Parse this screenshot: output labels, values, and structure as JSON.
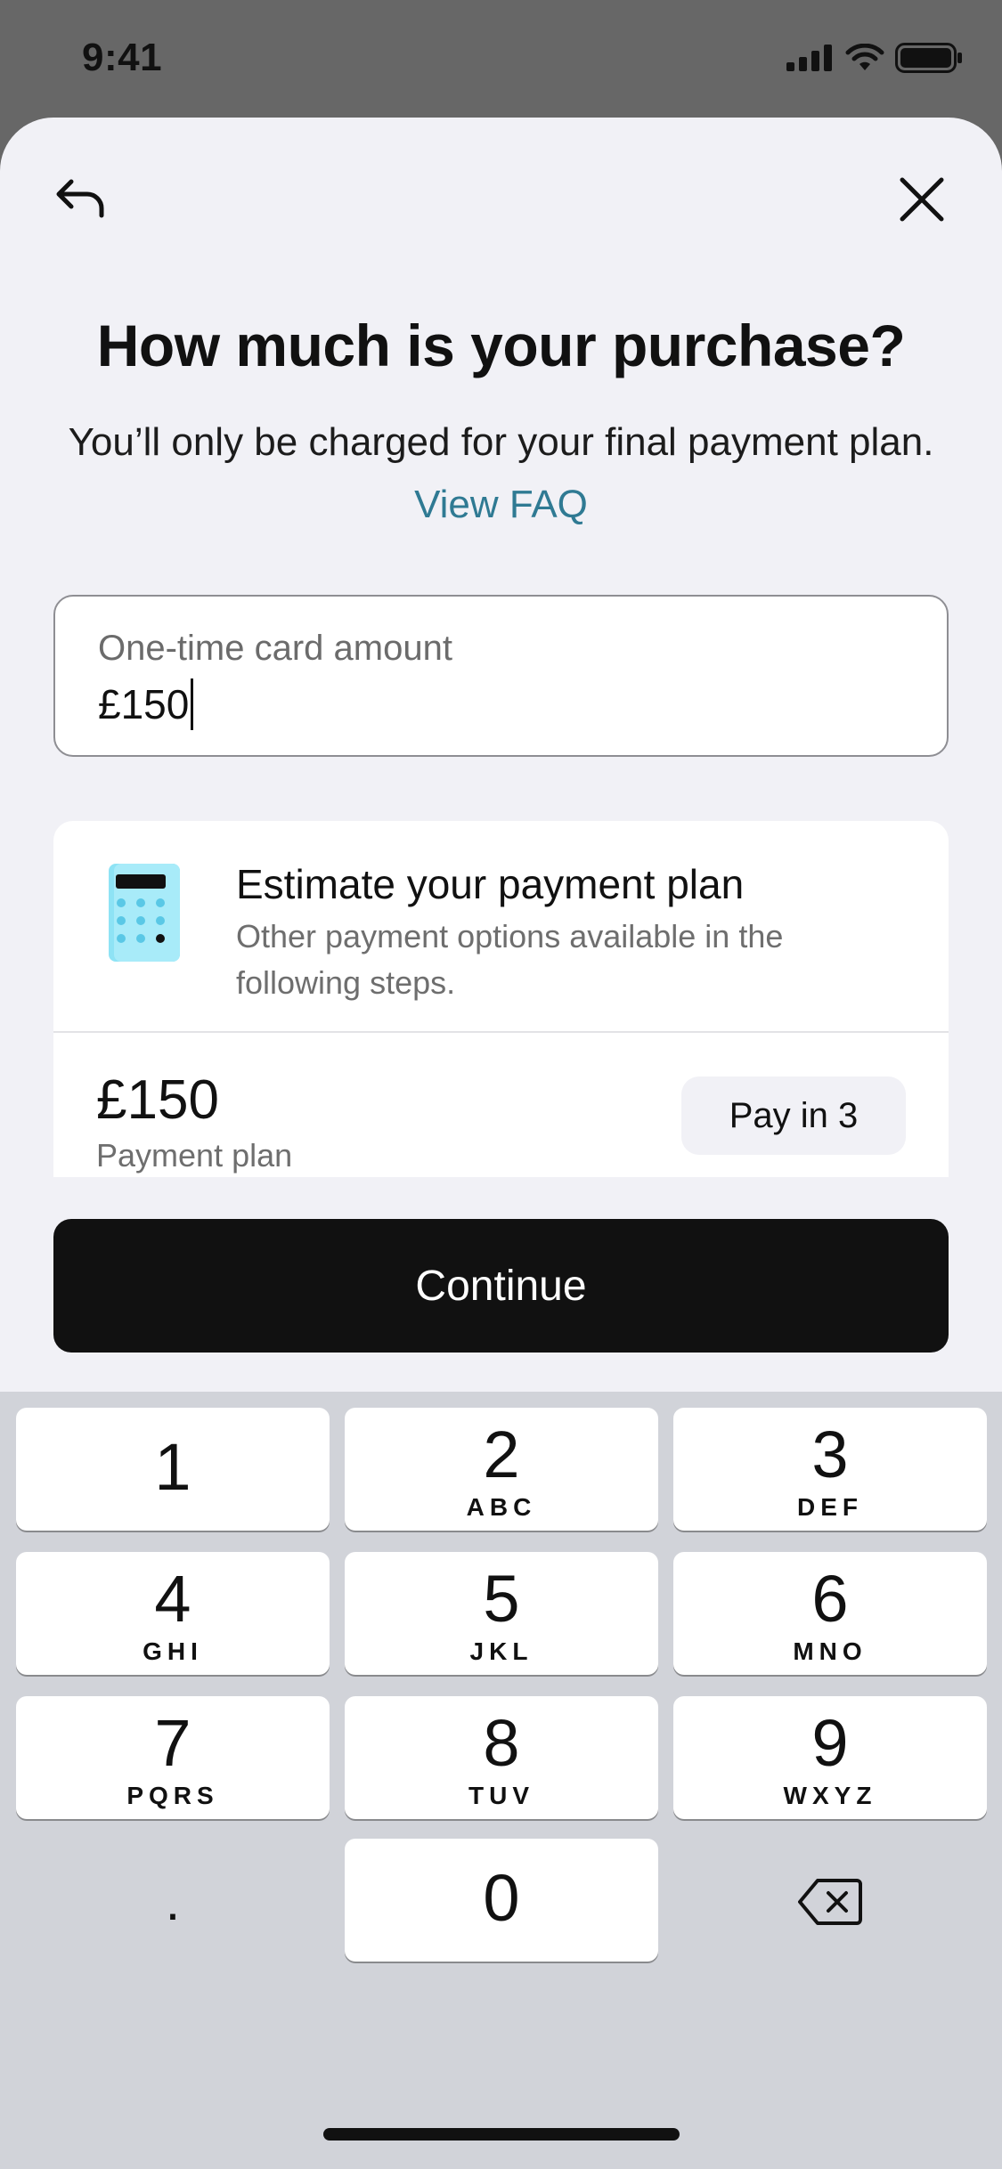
{
  "status_bar": {
    "time": "9:41"
  },
  "header": {
    "title": "How much is your purchase?"
  },
  "subtitle": {
    "text": "You’ll only be charged for your final payment plan.",
    "link": "View FAQ"
  },
  "amount_field": {
    "label": "One-time card amount",
    "value": "£150"
  },
  "estimate": {
    "title": "Estimate your payment plan",
    "description": "Other payment options available in the following steps.",
    "plan_amount": "£150",
    "plan_label": "Payment plan",
    "plan_button": "Pay in 3"
  },
  "continue_label": "Continue",
  "keypad": {
    "keys": [
      {
        "num": "1",
        "letters": ""
      },
      {
        "num": "2",
        "letters": "ABC"
      },
      {
        "num": "3",
        "letters": "DEF"
      },
      {
        "num": "4",
        "letters": "GHI"
      },
      {
        "num": "5",
        "letters": "JKL"
      },
      {
        "num": "6",
        "letters": "MNO"
      },
      {
        "num": "7",
        "letters": "PQRS"
      },
      {
        "num": "8",
        "letters": "TUV"
      },
      {
        "num": "9",
        "letters": "WXYZ"
      }
    ],
    "decimal": ".",
    "zero": "0"
  },
  "colors": {
    "link": "#2f7a93",
    "button": "#111111",
    "sheet": "#f1f1f6",
    "keyboard": "#d1d3d9"
  },
  "icons": [
    "signal-icon",
    "wifi-icon",
    "battery-icon",
    "back-arrow-icon",
    "close-icon",
    "calculator-icon",
    "backspace-icon"
  ]
}
